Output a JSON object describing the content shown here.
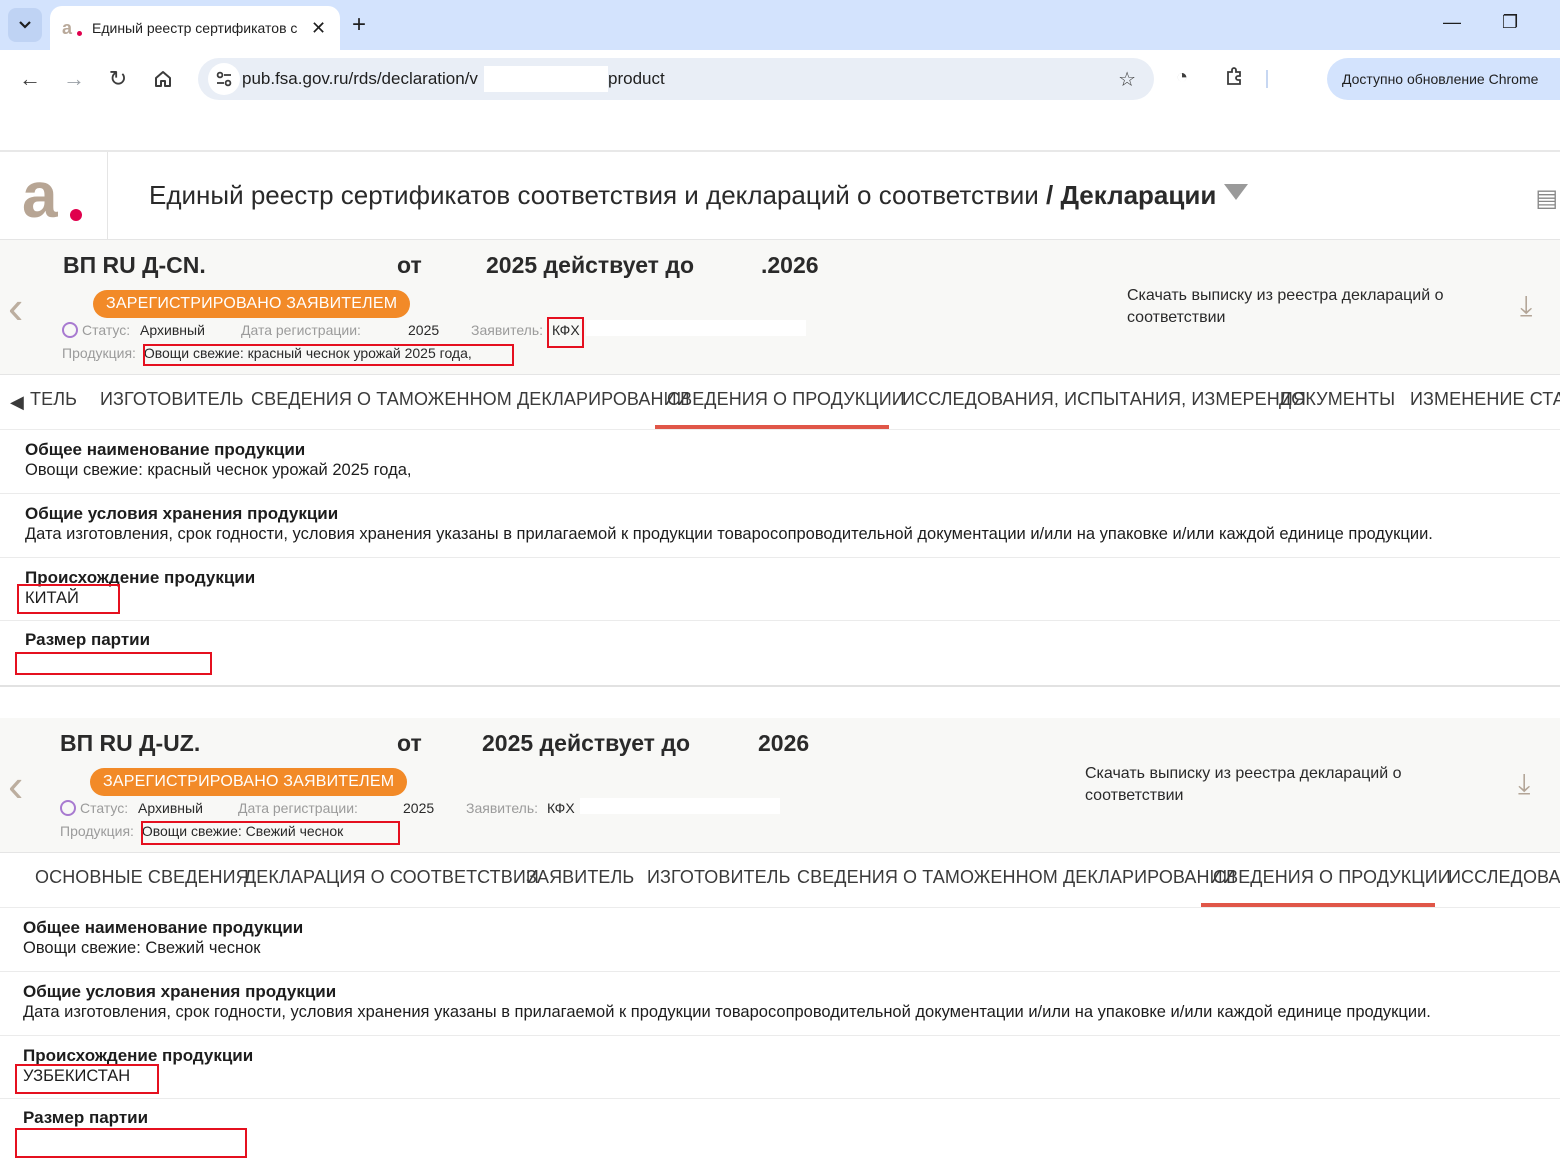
{
  "browser": {
    "tab_title": "Единый реестр сертификатов соответствия и деклараций",
    "url_prefix": "pub.fsa.gov.ru/rds/declaration/v",
    "url_suffix": "product",
    "update_label": "Доступно обновление Chrome"
  },
  "site": {
    "title": "Единый реестр сертификатов соответствия и деклараций о соответствии",
    "section": "/ Декларации"
  },
  "declarations": [
    {
      "number_prefix": "ВП RU Д-CN.",
      "from_label": "от",
      "year_text": "2025 действует до",
      "until_year": ".2026",
      "badge": "ЗАРЕГИСТРИРОВАНО ЗАЯВИТЕЛЕМ",
      "status_label": "Статус:",
      "status_value": "Архивный",
      "reg_label": "Дата регистрации:",
      "reg_value": "2025",
      "applicant_label": "Заявитель:",
      "applicant_value": "КФХ",
      "product_label": "Продукция:",
      "product_value": "Овощи свежие: красный чеснок урожай 2025 года,",
      "download_text": "Скачать выписку из реестра деклараций о соответствии",
      "tabs": [
        "ТЕЛЬ",
        "ИЗГОТОВИТЕЛЬ",
        "СВЕДЕНИЯ О ТАМОЖЕННОМ ДЕКЛАРИРОВАНИИ",
        "СВЕДЕНИЯ О ПРОДУКЦИИ",
        "ИССЛЕДОВАНИЯ, ИСПЫТАНИЯ, ИЗМЕРЕНИЯ",
        "ДОКУМЕНТЫ",
        "ИЗМЕНЕНИЕ СТАТУ"
      ],
      "active_tab": "СВЕДЕНИЯ О ПРОДУКЦИИ",
      "fields": [
        {
          "label": "Общее наименование продукции",
          "value": "Овощи свежие: красный чеснок урожай 2025 года,"
        },
        {
          "label": "Общие условия хранения продукции",
          "value": "Дата изготовления, срок годности, условия хранения указаны в прилагаемой к продукции товаросопроводительной документации и/или на упаковке и/или каждой единице продукции."
        },
        {
          "label": "Происхождение продукции",
          "value": "КИТАЙ"
        },
        {
          "label": "Размер партии",
          "value": ""
        }
      ]
    },
    {
      "number_prefix": "ВП RU Д-UZ.",
      "from_label": "от",
      "year_text": "2025 действует до",
      "until_year": "2026",
      "badge": "ЗАРЕГИСТРИРОВАНО ЗАЯВИТЕЛЕМ",
      "status_label": "Статус:",
      "status_value": "Архивный",
      "reg_label": "Дата регистрации:",
      "reg_value": "2025",
      "applicant_label": "Заявитель:",
      "applicant_value": "КФХ",
      "product_label": "Продукция:",
      "product_value": "Овощи свежие: Свежий чеснок",
      "download_text": "Скачать выписку из реестра деклараций о соответствии",
      "tabs": [
        "ОСНОВНЫЕ СВЕДЕНИЯ",
        "ДЕКЛАРАЦИЯ О СООТВЕТСТВИИ",
        "ЗАЯВИТЕЛЬ",
        "ИЗГОТОВИТЕЛЬ",
        "СВЕДЕНИЯ О ТАМОЖЕННОМ ДЕКЛАРИРОВАНИИ",
        "СВЕДЕНИЯ О ПРОДУКЦИИ",
        "ИССЛЕДОВАН"
      ],
      "active_tab": "СВЕДЕНИЯ О ПРОДУКЦИИ",
      "fields": [
        {
          "label": "Общее наименование продукции",
          "value": "Овощи свежие: Свежий чеснок"
        },
        {
          "label": "Общие условия хранения продукции",
          "value": "Дата изготовления, срок годности, условия хранения указаны в прилагаемой к продукции товаросопроводительной документации и/или на упаковке и/или каждой единице продукции."
        },
        {
          "label": "Происхождение продукции",
          "value": "УЗБЕКИСТАН"
        },
        {
          "label": "Размер партии",
          "value": ""
        }
      ]
    }
  ]
}
